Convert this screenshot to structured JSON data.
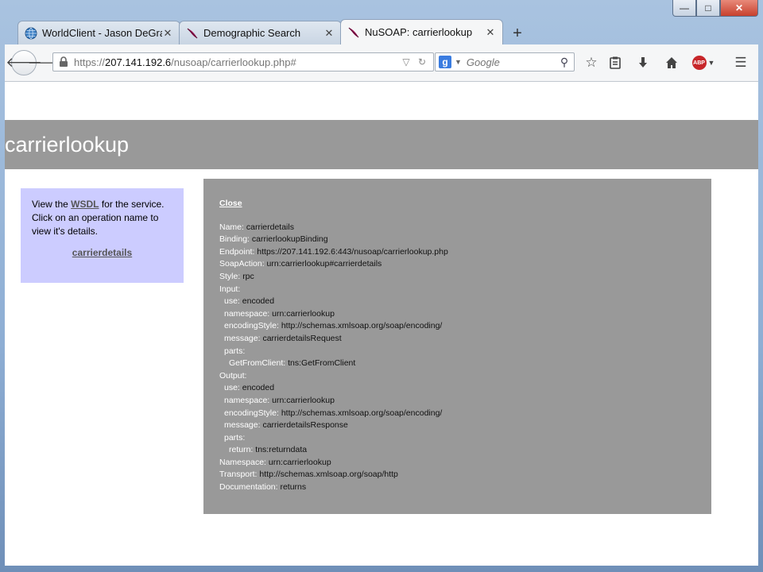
{
  "tabs": [
    {
      "label": "WorldClient - Jason DeGraf...",
      "icon": "globe-icon",
      "active": false
    },
    {
      "label": "Demographic Search",
      "icon": "feather-icon",
      "active": false
    },
    {
      "label": "NuSOAP: carrierlookup",
      "icon": "feather-icon",
      "active": true
    }
  ],
  "address": {
    "scheme": "https://",
    "host": "207.141.192.6",
    "path": "/nusoap/carrierlookup.php#"
  },
  "search": {
    "placeholder": "Google",
    "engine": "g"
  },
  "page": {
    "title": "carrierlookup",
    "intro_before": "View the ",
    "wsdl_link": "WSDL",
    "intro_after": " for the service. Click on an operation name to view it's details.",
    "operation_link": "carrierdetails"
  },
  "detail": {
    "close_label": "Close",
    "rows": [
      {
        "key": "Name:",
        "value": "carrierdetails",
        "indent": 0
      },
      {
        "key": "Binding:",
        "value": "carrierlookupBinding",
        "indent": 0
      },
      {
        "key": "Endpoint:",
        "value": "https://207.141.192.6:443/nusoap/carrierlookup.php",
        "indent": 0
      },
      {
        "key": "SoapAction:",
        "value": "urn:carrierlookup#carrierdetails",
        "indent": 0
      },
      {
        "key": "Style:",
        "value": "rpc",
        "indent": 0
      },
      {
        "key": "Input:",
        "value": "",
        "indent": 0
      },
      {
        "key": "use:",
        "value": "encoded",
        "indent": 1
      },
      {
        "key": "namespace:",
        "value": "urn:carrierlookup",
        "indent": 1
      },
      {
        "key": "encodingStyle:",
        "value": "http://schemas.xmlsoap.org/soap/encoding/",
        "indent": 1
      },
      {
        "key": "message:",
        "value": "carrierdetailsRequest",
        "indent": 1
      },
      {
        "key": "parts:",
        "value": "",
        "indent": 1
      },
      {
        "key": "GetFromClient:",
        "value": "tns:GetFromClient",
        "indent": 2
      },
      {
        "key": "Output:",
        "value": "",
        "indent": 0
      },
      {
        "key": "use:",
        "value": "encoded",
        "indent": 1
      },
      {
        "key": "namespace:",
        "value": "urn:carrierlookup",
        "indent": 1
      },
      {
        "key": "encodingStyle:",
        "value": "http://schemas.xmlsoap.org/soap/encoding/",
        "indent": 1
      },
      {
        "key": "message:",
        "value": "carrierdetailsResponse",
        "indent": 1
      },
      {
        "key": "parts:",
        "value": "",
        "indent": 1
      },
      {
        "key": "return:",
        "value": "tns:returndata",
        "indent": 2
      },
      {
        "key": "Namespace:",
        "value": "urn:carrierlookup",
        "indent": 0
      },
      {
        "key": "Transport:",
        "value": "http://schemas.xmlsoap.org/soap/http",
        "indent": 0
      },
      {
        "key": "Documentation:",
        "value": "returns",
        "indent": 0
      }
    ]
  }
}
